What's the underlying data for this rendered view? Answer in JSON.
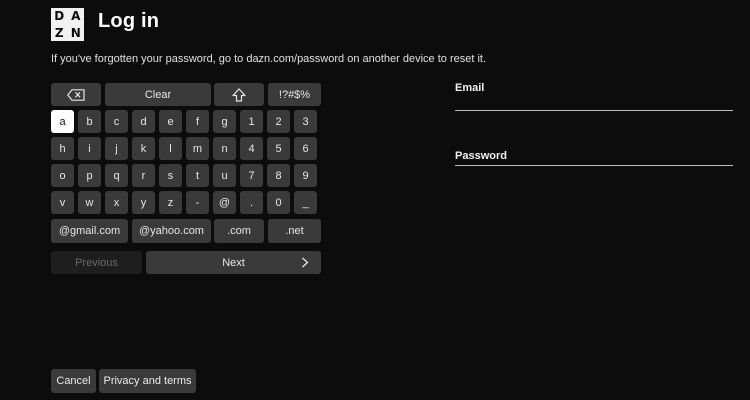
{
  "logo": {
    "letters": [
      "D",
      "A",
      "Z",
      "N"
    ]
  },
  "title": "Log in",
  "hint": "If you've forgotten your password, go to dazn.com/password on another device to reset it.",
  "keyboard": {
    "top_row": {
      "backspace_icon": "backspace-icon",
      "clear": "Clear",
      "shift_icon": "shift-icon",
      "symbols": "!?#$%"
    },
    "rows": [
      [
        "a",
        "b",
        "c",
        "d",
        "e",
        "f",
        "g",
        "1",
        "2",
        "3"
      ],
      [
        "h",
        "i",
        "j",
        "k",
        "l",
        "m",
        "n",
        "4",
        "5",
        "6"
      ],
      [
        "o",
        "p",
        "q",
        "r",
        "s",
        "t",
        "u",
        "7",
        "8",
        "9"
      ],
      [
        "v",
        "w",
        "x",
        "y",
        "z",
        "-",
        "@",
        ".",
        "0",
        "_"
      ]
    ],
    "shortcuts": [
      "@gmail.com",
      "@yahoo.com",
      ".com",
      ".net"
    ],
    "selected_key": "a",
    "previous": "Previous",
    "next": "Next",
    "next_icon": "chevron-right-icon"
  },
  "form": {
    "email_label": "Email",
    "email_value": "",
    "password_label": "Password",
    "password_value": ""
  },
  "footer": {
    "cancel": "Cancel",
    "privacy": "Privacy and terms"
  }
}
